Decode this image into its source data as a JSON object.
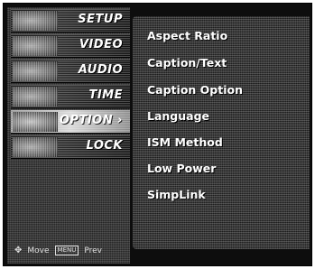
{
  "sidebar": {
    "tabs": [
      {
        "label": "SETUP"
      },
      {
        "label": "VIDEO"
      },
      {
        "label": "AUDIO"
      },
      {
        "label": "TIME"
      },
      {
        "label": "OPTION ›",
        "selected": true
      },
      {
        "label": "LOCK"
      }
    ]
  },
  "hints": {
    "move_label": "Move",
    "menu_key": "MENU",
    "prev_label": "Prev"
  },
  "option_menu": {
    "items": [
      {
        "label": "Aspect Ratio"
      },
      {
        "label": "Caption/Text"
      },
      {
        "label": "Caption Option"
      },
      {
        "label": "Language"
      },
      {
        "label": "ISM Method"
      },
      {
        "label": "Low Power"
      },
      {
        "label": "SimpLink"
      }
    ]
  }
}
